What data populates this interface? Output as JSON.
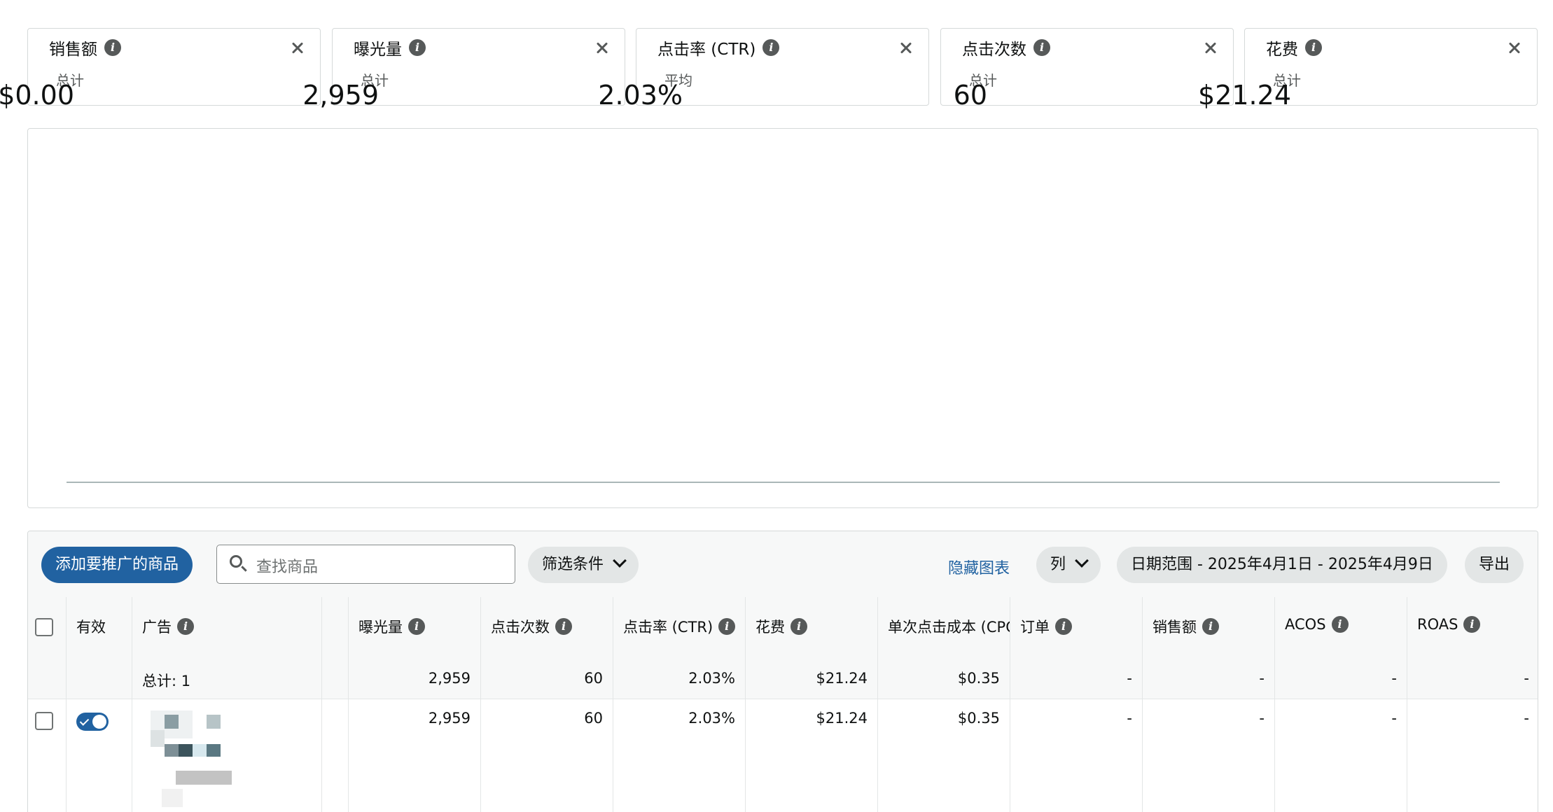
{
  "metrics": [
    {
      "label": "销售额",
      "value": "$0.00",
      "unit": "总计"
    },
    {
      "label": "曝光量",
      "value": "2,959",
      "unit": "总计"
    },
    {
      "label": "点击率 (CTR)",
      "value": "2.03%",
      "unit": "平均"
    },
    {
      "label": "点击次数",
      "value": "60",
      "unit": "总计"
    },
    {
      "label": "花费",
      "value": "$21.24",
      "unit": "总计"
    }
  ],
  "toolbar": {
    "add_button": "添加要推广的商品",
    "search_placeholder": "查找商品",
    "filter_label": "筛选条件",
    "hide_chart": "隐藏图表",
    "columns_label": "列",
    "date_range": "日期范围 - 2025年4月1日 - 2025年4月9日",
    "export_label": "导出"
  },
  "table": {
    "headers": {
      "active": "有效",
      "ad": "广告",
      "impressions": "曝光量",
      "clicks": "点击次数",
      "ctr": "点击率 (CTR)",
      "spend": "花费",
      "cpc": "单次点击成本 (CPC)",
      "orders": "订单",
      "sales": "销售额",
      "acos": "ACOS",
      "roas": "ROAS"
    },
    "total_row": {
      "label": "总计: 1",
      "impressions": "2,959",
      "clicks": "60",
      "ctr": "2.03%",
      "spend": "$21.24",
      "cpc": "$0.35",
      "orders": "-",
      "sales": "-",
      "acos": "-",
      "roas": "-"
    },
    "rows": [
      {
        "active": true,
        "impressions": "2,959",
        "clicks": "60",
        "ctr": "2.03%",
        "spend": "$21.24",
        "cpc": "$0.35",
        "orders": "-",
        "sales": "-",
        "acos": "-",
        "roas": "-"
      }
    ]
  },
  "colors": {
    "primary": "#2162a1",
    "border": "#d5d9d9",
    "header_bg": "#f7f8f8",
    "pill_bg": "#e3e6e6"
  }
}
